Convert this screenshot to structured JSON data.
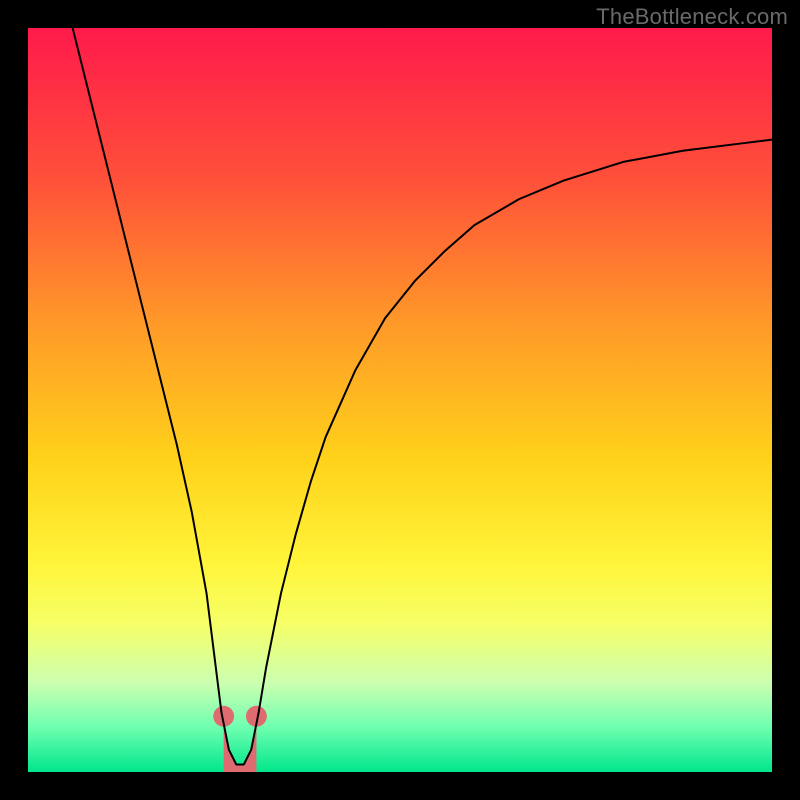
{
  "watermark": "TheBottleneck.com",
  "chart_data": {
    "type": "line",
    "title": "",
    "xlabel": "",
    "ylabel": "",
    "xlim": [
      0,
      100
    ],
    "ylim": [
      0,
      100
    ],
    "grid": false,
    "legend": "none",
    "background_gradient_stops": [
      {
        "pos": 0.0,
        "color": "#ff1a4b"
      },
      {
        "pos": 0.2,
        "color": "#ff4f3a"
      },
      {
        "pos": 0.4,
        "color": "#ff9a28"
      },
      {
        "pos": 0.58,
        "color": "#ffd21a"
      },
      {
        "pos": 0.72,
        "color": "#fff53a"
      },
      {
        "pos": 0.8,
        "color": "#f6ff66"
      },
      {
        "pos": 0.88,
        "color": "#ccffb0"
      },
      {
        "pos": 0.94,
        "color": "#6effb0"
      },
      {
        "pos": 1.0,
        "color": "#00e68c"
      }
    ],
    "series": [
      {
        "name": "bottleneck-curve",
        "stroke": "#000000",
        "stroke_width": 2,
        "x": [
          6.0,
          8.0,
          10.0,
          12.0,
          14.0,
          16.0,
          18.0,
          20.0,
          22.0,
          24.0,
          25.0,
          26.0,
          27.0,
          28.0,
          29.0,
          30.0,
          31.0,
          32.0,
          34.0,
          36.0,
          38.0,
          40.0,
          44.0,
          48.0,
          52.0,
          56.0,
          60.0,
          66.0,
          72.0,
          80.0,
          88.0,
          96.0,
          100.0
        ],
        "y": [
          100.0,
          92.0,
          84.0,
          76.0,
          68.0,
          60.0,
          52.0,
          44.0,
          35.0,
          24.0,
          16.0,
          8.0,
          3.0,
          1.0,
          1.0,
          3.0,
          8.0,
          14.0,
          24.0,
          32.0,
          39.0,
          45.0,
          54.0,
          61.0,
          66.0,
          70.0,
          73.5,
          77.0,
          79.5,
          82.0,
          83.5,
          84.5,
          85.0
        ]
      }
    ],
    "markers": [
      {
        "name": "left-valley-point",
        "x": 26.3,
        "y": 7.5,
        "r": 1.4,
        "color": "#dd6b6f"
      },
      {
        "name": "right-valley-point",
        "x": 30.7,
        "y": 7.5,
        "r": 1.4,
        "color": "#dd6b6f"
      }
    ],
    "valley_fill": {
      "color": "#dd6b6f",
      "poly_x": [
        26.3,
        27.0,
        28.0,
        29.0,
        30.0,
        30.7,
        30.7,
        26.3
      ],
      "poly_y": [
        7.5,
        3.0,
        1.0,
        1.0,
        3.0,
        7.5,
        0.0,
        0.0
      ]
    }
  }
}
